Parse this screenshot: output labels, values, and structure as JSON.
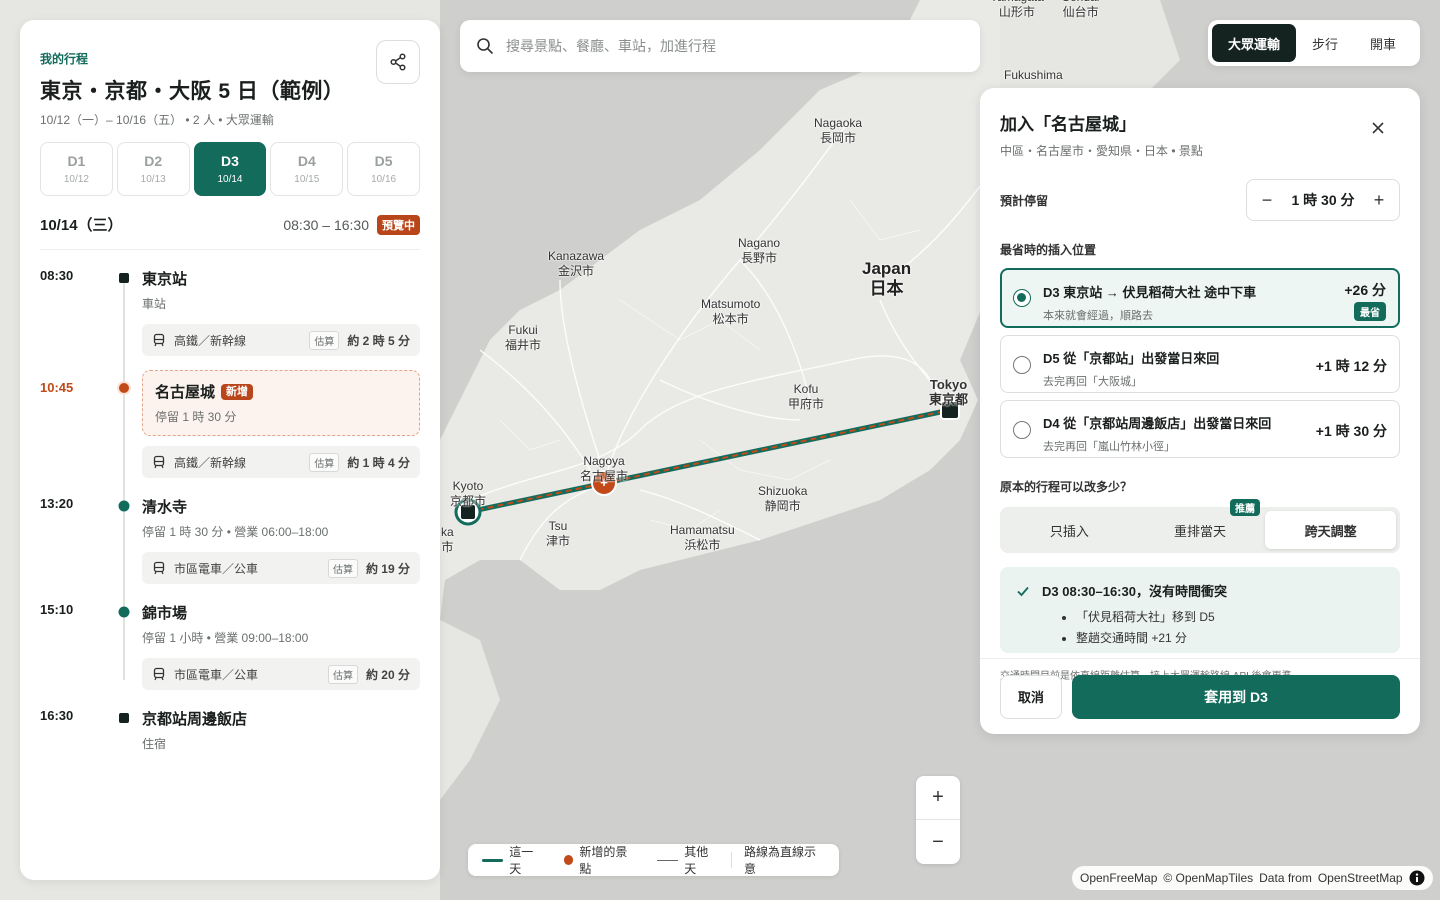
{
  "map": {
    "labels": [
      {
        "id": "yamagata",
        "text": "Yamagata\n山形市"
      },
      {
        "id": "sendai",
        "text": "Sendai\n仙台市"
      },
      {
        "id": "fukushima",
        "text": "Fukushima"
      },
      {
        "id": "nagaoka",
        "text": "Nagaoka\n長岡市"
      },
      {
        "id": "kanazawa",
        "text": "Kanazawa\n金沢市"
      },
      {
        "id": "nagano",
        "text": "Nagano\n長野市"
      },
      {
        "id": "japan",
        "text": "Japan\n日本"
      },
      {
        "id": "matsumoto",
        "text": "Matsumoto\n松本市"
      },
      {
        "id": "fukui",
        "text": "Fukui\n福井市"
      },
      {
        "id": "kofu",
        "text": "Kofu\n甲府市"
      },
      {
        "id": "tokyo",
        "text": "Tokyo\n東京都"
      },
      {
        "id": "nagoya",
        "text": "Nagoya\n名古屋市"
      },
      {
        "id": "shizuoka",
        "text": "Shizuoka\n静岡市"
      },
      {
        "id": "kyoto",
        "text": "Kyoto\n京都市"
      },
      {
        "id": "tsu",
        "text": "Tsu\n津市"
      },
      {
        "id": "hamamatsu",
        "text": "Hamamatsu\n浜松市"
      },
      {
        "id": "osaka",
        "text": "ka\n市"
      }
    ]
  },
  "left": {
    "kicker": "我的行程",
    "title": "東京・京都・大阪 5 日（範例）",
    "meta": "10/12（一）– 10/16（五） • 2 人 • 大眾運輸",
    "days": [
      {
        "label": "D1",
        "date": "10/12"
      },
      {
        "label": "D2",
        "date": "10/13"
      },
      {
        "label": "D3",
        "date": "10/14"
      },
      {
        "label": "D4",
        "date": "10/15"
      },
      {
        "label": "D5",
        "date": "10/16"
      }
    ],
    "day_date": "10/14（三）",
    "day_time": "08:30 – 16:30",
    "preview_badge": "預覽中",
    "stops": [
      {
        "time": "08:30",
        "name": "東京站",
        "sub": "車站"
      },
      {
        "time": "10:45",
        "name": "名古屋城",
        "badge": "新增",
        "sub": "停留 1 時 30 分"
      },
      {
        "time": "13:20",
        "name": "清水寺",
        "sub": "停留 1 時 30 分 • 營業 06:00–18:00"
      },
      {
        "time": "15:10",
        "name": "錦市場",
        "sub": "停留 1 小時 • 營業 09:00–18:00"
      },
      {
        "time": "16:30",
        "name": "京都站周邊飯店",
        "sub": "住宿"
      }
    ],
    "legs": [
      {
        "mode": "高鐵／新幹線",
        "est": "估算",
        "dur": "約 2 時 5 分"
      },
      {
        "mode": "高鐵／新幹線",
        "est": "估算",
        "dur": "約 1 時 4 分"
      },
      {
        "mode": "市區電車／公車",
        "est": "估算",
        "dur": "約 19 分"
      },
      {
        "mode": "市區電車／公車",
        "est": "估算",
        "dur": "約 20 分"
      }
    ]
  },
  "search": {
    "placeholder": "搜尋景點、餐廳、車站，加進行程"
  },
  "modes": {
    "transit": "大眾運輸",
    "walk": "步行",
    "drive": "開車"
  },
  "panel": {
    "title": "加入「名古屋城」",
    "sub": "中區・名古屋市・愛知県・日本 • 景點",
    "stay_label": "預計停留",
    "stay_value": "1 時 30 分",
    "minus": "−",
    "plus": "+",
    "insert_label": "最省時的插入位置",
    "options": [
      {
        "title": "D3 東京站 → 伏見稻荷大社 途中下車",
        "sub": "本來就會經過，順路去",
        "delta": "+26 分",
        "badge": "最省"
      },
      {
        "title": "D5 從「京都站」出發當日來回",
        "sub": "去完再回「大阪城」",
        "delta": "+1 時 12 分"
      },
      {
        "title": "D4 從「京都站周邊飯店」出發當日來回",
        "sub": "去完再回「嵐山竹林小徑」",
        "delta": "+1 時 30 分"
      }
    ],
    "change_label": "原本的行程可以改多少？",
    "segments": [
      "只插入",
      "重排當天",
      "跨天調整"
    ],
    "rec_badge": "推薦",
    "result_head": "D3 08:30–16:30，沒有時間衝突",
    "result_items": [
      "「伏見稻荷大社」移到 D5",
      "整趟交通時間 +21 分"
    ],
    "note": "交通時間目前是依直線距離估算，接上大眾運輸路線 API 後會更準。",
    "cancel": "取消",
    "apply": "套用到 D3"
  },
  "zoom": {
    "in": "+",
    "out": "−"
  },
  "legend": {
    "today": "這一天",
    "added": "新增的景點",
    "other": "其他天",
    "note": "路線為直線示意"
  },
  "attribution": {
    "ofm": "OpenFreeMap",
    "omt": "© OpenMapTiles",
    "from": "Data from",
    "osm": "OpenStreetMap"
  },
  "colors": {
    "accent": "#136b5c",
    "added": "#c14a18",
    "map_land": "#e6e6e2",
    "map_sea": "#cfd0cd"
  }
}
